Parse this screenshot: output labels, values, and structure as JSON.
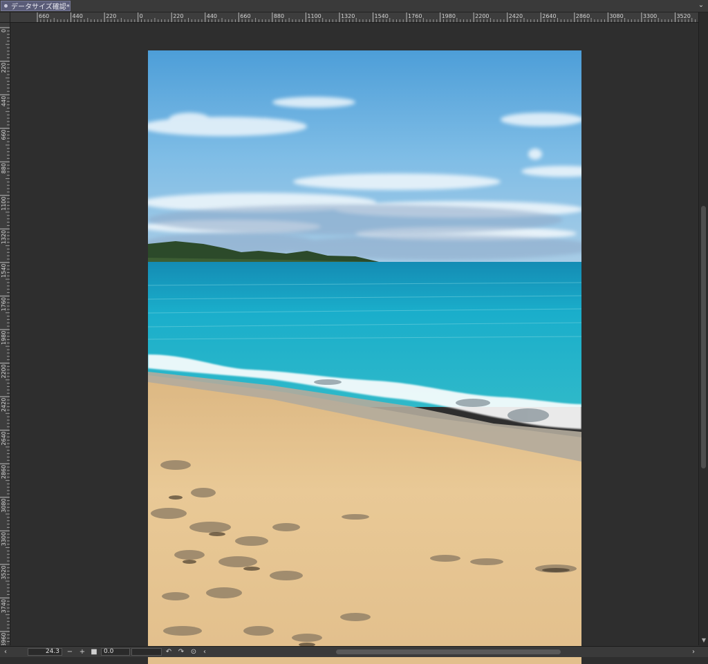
{
  "tab": {
    "title": "データサイズ確認*",
    "menu_icon": "chevron-down-icon"
  },
  "ruler_h": [
    "660",
    "440",
    "220",
    "0",
    "220",
    "440",
    "660",
    "880",
    "1100",
    "1320",
    "1540",
    "1760",
    "1980",
    "2200",
    "2420",
    "2640",
    "2860",
    "3080",
    "3300",
    "3520"
  ],
  "ruler_v": [
    "0",
    "220",
    "440",
    "660",
    "880",
    "1100",
    "1320",
    "1540",
    "1760",
    "1980",
    "2200",
    "2420",
    "2640",
    "2860",
    "3080",
    "3300",
    "3520",
    "3740",
    "3960"
  ],
  "canvas": {
    "description": "beach painting artwork"
  },
  "bottombar": {
    "zoom": "24.3",
    "rotation": "0.0",
    "zoom_out": "−",
    "zoom_in": "+",
    "fit": "■",
    "rotate_left": "↶",
    "rotate_right": "↷",
    "reset": "⊙",
    "scroll_left": "‹",
    "scroll_right": "›"
  },
  "colors": {
    "sky": "#5aa6dc",
    "sea": "#1aa8c2",
    "sand": "#e6c48f",
    "workspace": "#2e2e2e"
  }
}
